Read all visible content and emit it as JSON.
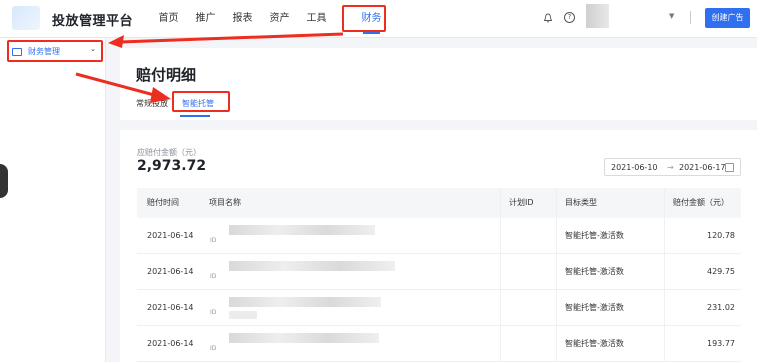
{
  "app": {
    "title": "投放管理平台"
  },
  "nav": [
    {
      "label": "首页"
    },
    {
      "label": "推广"
    },
    {
      "label": "报表"
    },
    {
      "label": "资产"
    },
    {
      "label": "工具"
    },
    {
      "label": "财务"
    }
  ],
  "header": {
    "create_label": "创建广告",
    "help_glyph": "?"
  },
  "sidebar": {
    "item_label": "财务管理"
  },
  "page": {
    "title": "赔付明细",
    "tabs": [
      {
        "label": "常规投放"
      },
      {
        "label": "智能托管"
      }
    ]
  },
  "summary": {
    "label": "应赔付金额（元）",
    "amount": "2,973.72"
  },
  "daterange": {
    "start": "2021-06-10",
    "sep": "→",
    "end": "2021-06-17"
  },
  "table": {
    "columns": [
      "赔付时间",
      "项目名称",
      "计划ID",
      "目标类型",
      "赔付金额（元）"
    ],
    "rows": [
      {
        "date": "2021-06-14",
        "id_label": "ID",
        "type": "智能托管-激活数",
        "amount": "120.78"
      },
      {
        "date": "2021-06-14",
        "id_label": "ID",
        "type": "智能托管-激活数",
        "amount": "429.75"
      },
      {
        "date": "2021-06-14",
        "id_label": "ID",
        "type": "智能托管-激活数",
        "amount": "231.02"
      },
      {
        "date": "2021-06-14",
        "id_label": "ID",
        "type": "智能托管-激活数",
        "amount": "193.77"
      }
    ]
  },
  "colors": {
    "accent": "#2f6ff0",
    "highlight": "#ec2d1f"
  }
}
